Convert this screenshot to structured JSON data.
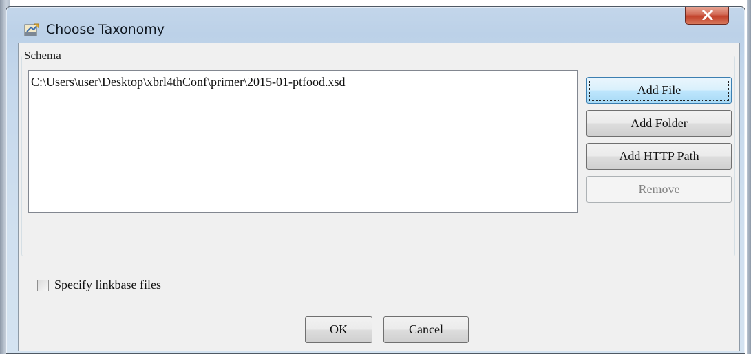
{
  "window": {
    "title": "Choose Taxonomy",
    "close_label": "X"
  },
  "schema": {
    "group_label": "Schema",
    "files": [
      "C:\\Users\\user\\Desktop\\xbrl4thConf\\primer\\2015-01-ptfood.xsd"
    ]
  },
  "buttons": {
    "add_file": "Add File",
    "add_folder": "Add Folder",
    "add_http_path": "Add HTTP Path",
    "remove": "Remove"
  },
  "options": {
    "specify_linkbase_label": "Specify linkbase files",
    "specify_linkbase_checked": false
  },
  "footer": {
    "ok": "OK",
    "cancel": "Cancel"
  },
  "colors": {
    "title_bar": "#bcd1e8",
    "close_button": "#c2412b",
    "default_button": "#bee6fd"
  }
}
